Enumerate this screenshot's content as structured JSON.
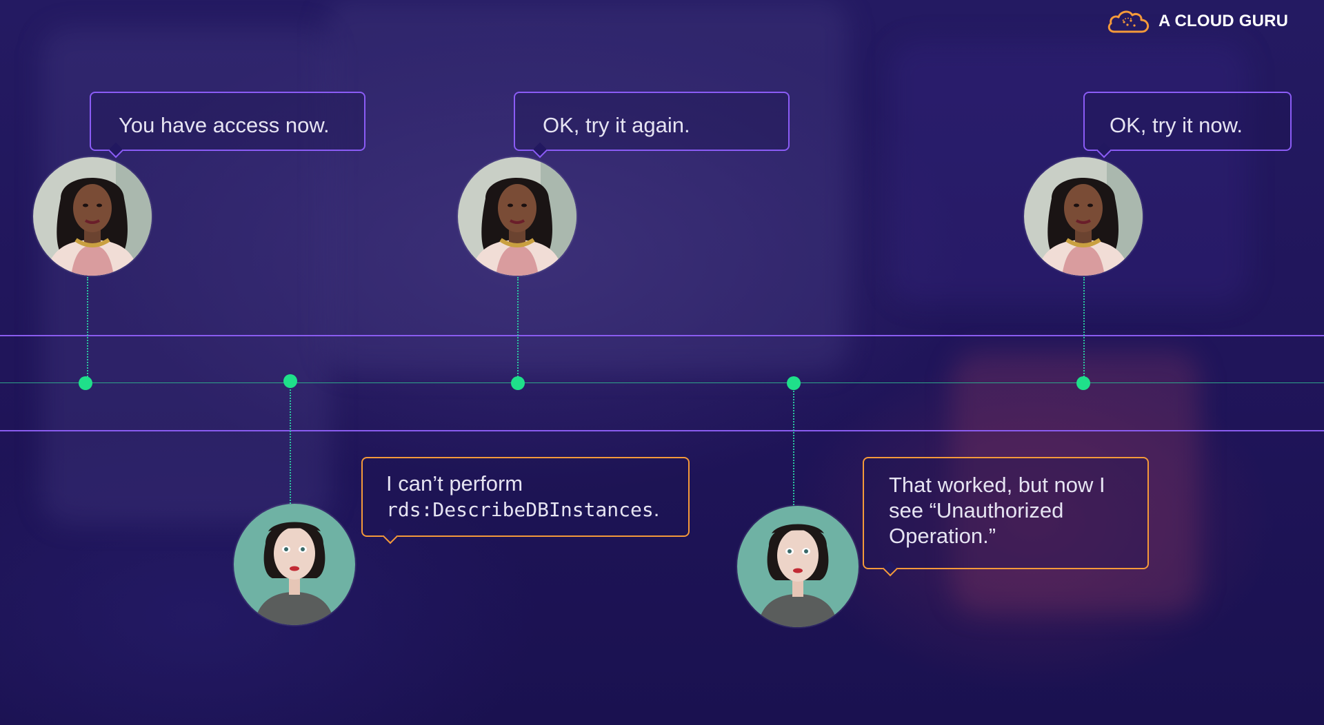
{
  "brand": {
    "name": "A CLOUD GURU",
    "logo_icon": "cloud-logo-icon",
    "accent": "#f59a3a"
  },
  "colors": {
    "timeline_band": "#8a5cf0",
    "timeline_line": "#2ea48a",
    "event_dot": "#1fe08a",
    "admin_bubble": "#8b5cf6",
    "user_bubble": "#f59a3a"
  },
  "admin_messages": [
    {
      "text": "You have access now."
    },
    {
      "text": "OK, try it again."
    },
    {
      "text": "OK, try it now."
    }
  ],
  "user_messages": [
    {
      "line1": "I can’t perform",
      "code": "rds:DescribeDBInstances",
      "suffix": "."
    },
    {
      "line1": "That worked, but now I",
      "line2": "see “Unauthorized",
      "line3": "Operation.”"
    }
  ],
  "timeline_events": [
    {
      "speaker": "admin",
      "order": 1
    },
    {
      "speaker": "user",
      "order": 2
    },
    {
      "speaker": "admin",
      "order": 3
    },
    {
      "speaker": "user",
      "order": 4
    },
    {
      "speaker": "admin",
      "order": 5
    }
  ]
}
